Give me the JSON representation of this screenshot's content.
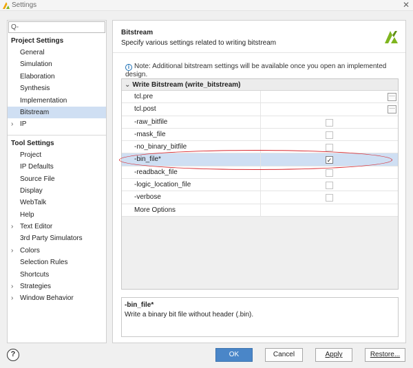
{
  "window": {
    "title": "Settings",
    "close": "✕"
  },
  "search": {
    "placeholder": "",
    "glyph": "Q-"
  },
  "sidebar": {
    "project_settings": {
      "heading": "Project Settings",
      "items": [
        {
          "label": "General"
        },
        {
          "label": "Simulation"
        },
        {
          "label": "Elaboration"
        },
        {
          "label": "Synthesis"
        },
        {
          "label": "Implementation"
        },
        {
          "label": "Bitstream",
          "selected": true
        },
        {
          "label": "IP",
          "expandable": true
        }
      ]
    },
    "tool_settings": {
      "heading": "Tool Settings",
      "items": [
        {
          "label": "Project"
        },
        {
          "label": "IP Defaults"
        },
        {
          "label": "Source File"
        },
        {
          "label": "Display"
        },
        {
          "label": "WebTalk"
        },
        {
          "label": "Help"
        },
        {
          "label": "Text Editor",
          "expandable": true
        },
        {
          "label": "3rd Party Simulators"
        },
        {
          "label": "Colors",
          "expandable": true
        },
        {
          "label": "Selection Rules"
        },
        {
          "label": "Shortcuts"
        },
        {
          "label": "Strategies",
          "expandable": true
        },
        {
          "label": "Window Behavior",
          "expandable": true
        }
      ]
    }
  },
  "panel": {
    "title": "Bitstream",
    "subtitle": "Specify various settings related to writing bitstream",
    "note": "Note: Additional bitstream settings will be available once you open an implemented design."
  },
  "grid": {
    "section": "Write Bitstream (write_bitstream)",
    "rows": [
      {
        "name": "tcl.pre",
        "control": "ellipsis"
      },
      {
        "name": "tcl.post",
        "control": "ellipsis"
      },
      {
        "name": "-raw_bitfile",
        "control": "checkbox",
        "checked": false
      },
      {
        "name": "-mask_file",
        "control": "checkbox",
        "checked": false
      },
      {
        "name": "-no_binary_bitfile",
        "control": "checkbox",
        "checked": false
      },
      {
        "name": "-bin_file*",
        "control": "checkbox",
        "checked": true,
        "selected": true
      },
      {
        "name": "-readback_file",
        "control": "checkbox",
        "checked": false
      },
      {
        "name": "-logic_location_file",
        "control": "checkbox",
        "checked": false
      },
      {
        "name": "-verbose",
        "control": "checkbox",
        "checked": false
      },
      {
        "name": "More Options",
        "control": "none"
      }
    ]
  },
  "description": {
    "title": "-bin_file*",
    "text": "Write a binary bit file without header (.bin)."
  },
  "footer": {
    "help": "?",
    "ok": "OK",
    "cancel": "Cancel",
    "apply": "Apply",
    "restore": "Restore..."
  },
  "colors": {
    "selection": "#cfdff3",
    "ok_button": "#4a86c8",
    "highlight_oval": "#d9262c",
    "logo_green": "#7fb51f"
  }
}
